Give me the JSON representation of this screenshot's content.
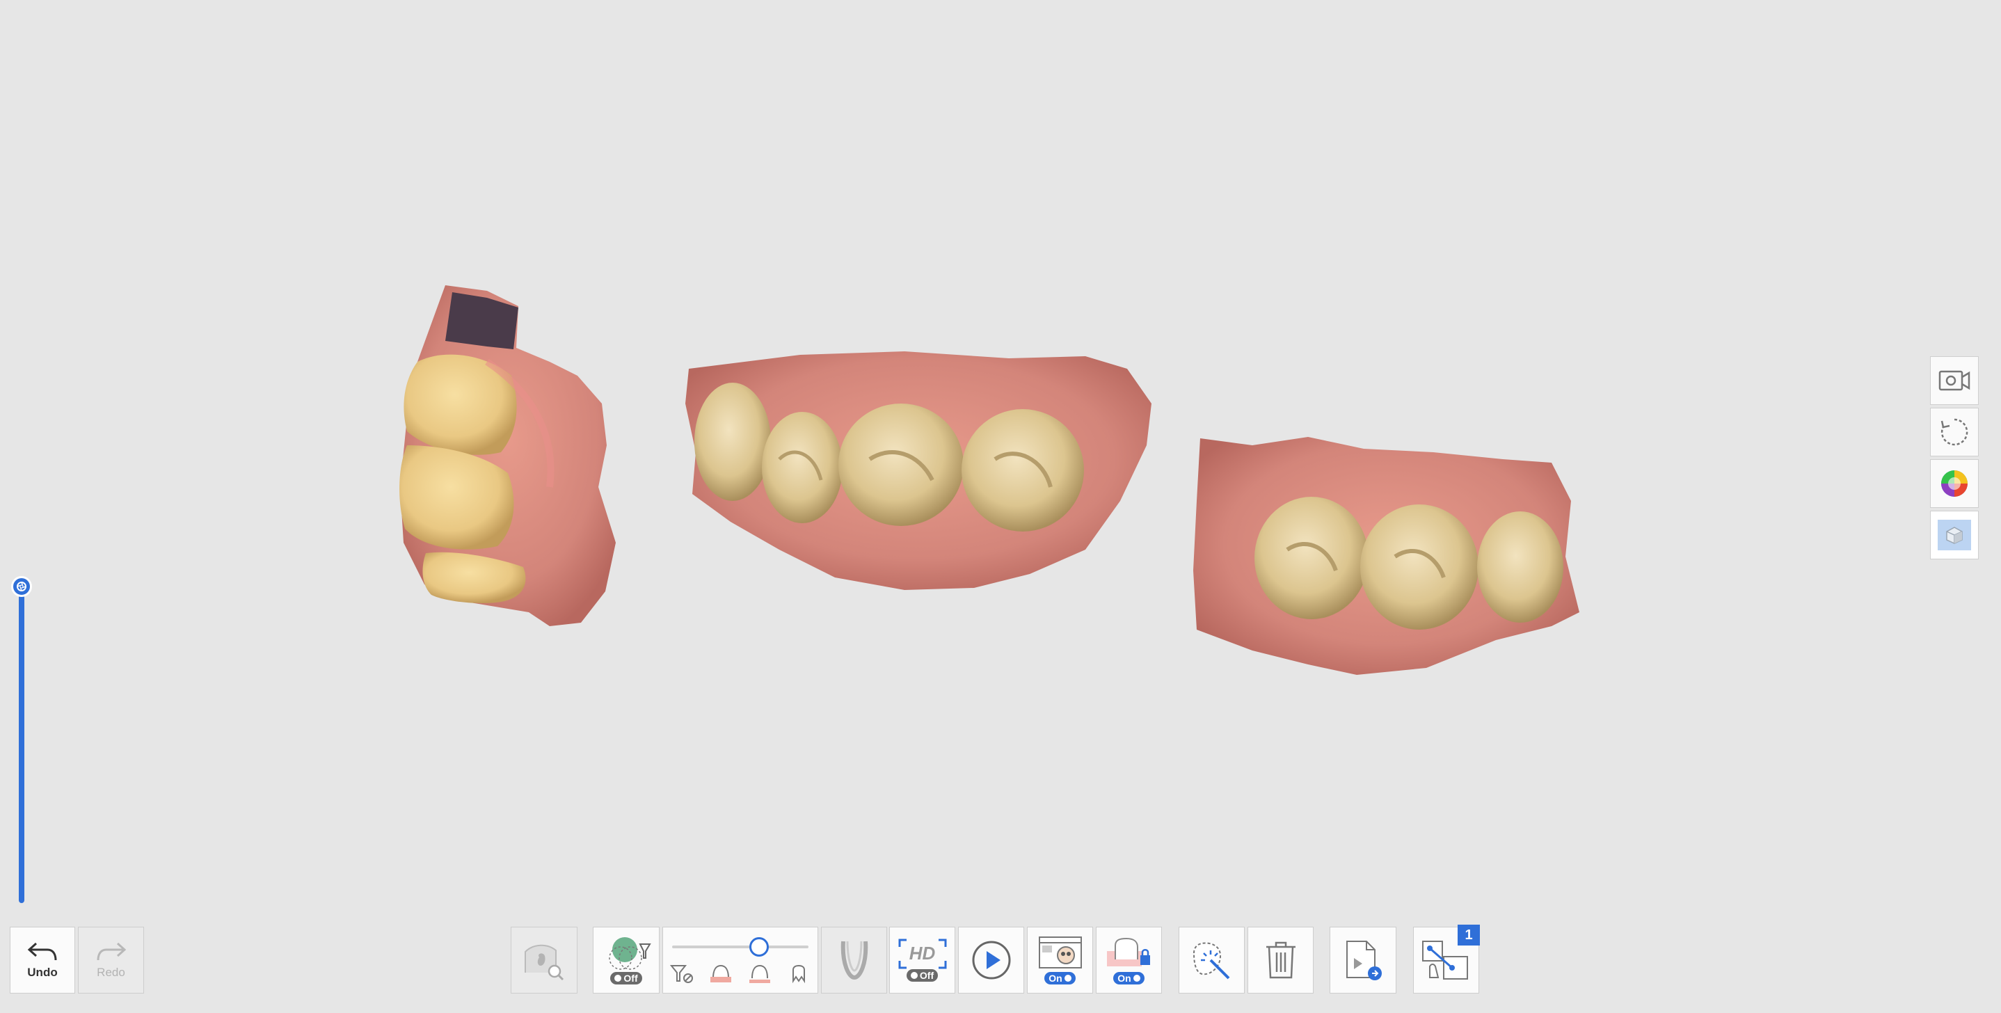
{
  "viewport": {
    "scan_models": [
      {
        "name": "anterior-scan"
      },
      {
        "name": "posterior-scan-center"
      },
      {
        "name": "posterior-scan-right"
      }
    ]
  },
  "side_panel": {
    "items": [
      {
        "icon": "camera-icon"
      },
      {
        "icon": "rotate-icon"
      },
      {
        "icon": "color-wheel-icon"
      },
      {
        "icon": "cube-icon"
      }
    ]
  },
  "toolbar": {
    "undo_label": "Undo",
    "redo_label": "Redo",
    "filter_toggle": "Off",
    "hd_label": "HD",
    "hd_toggle": "Off",
    "preview_toggle": "On",
    "lock_toggle": "On",
    "badge_count": "1",
    "tooth_slider_level": 0.66
  },
  "colors": {
    "accent": "#2f6fd8",
    "background": "#e6e6e6",
    "gum": "#d8897c",
    "tooth": "#e8d4a6"
  }
}
